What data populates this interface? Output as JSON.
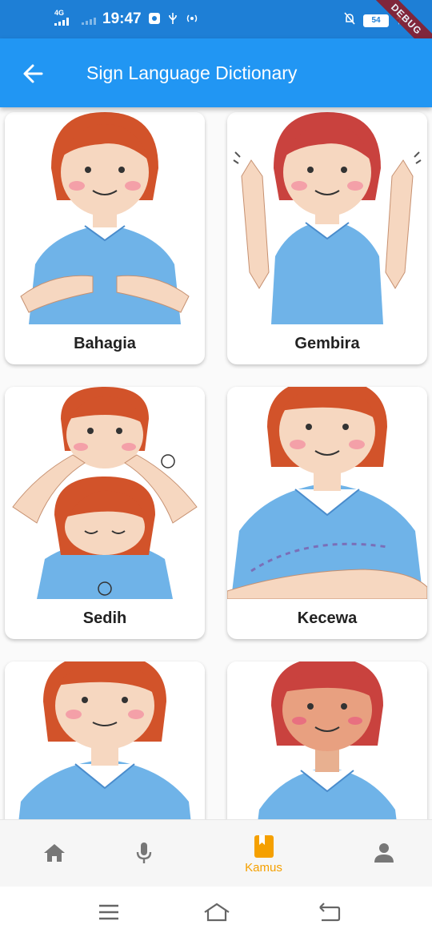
{
  "status_bar": {
    "network": "4G",
    "time": "19:47",
    "battery": "54",
    "debug": "DEBUG"
  },
  "app_bar": {
    "title": "Sign Language Dictionary"
  },
  "cards": [
    {
      "label": "Bahagia"
    },
    {
      "label": "Gembira"
    },
    {
      "label": "Sedih"
    },
    {
      "label": "Kecewa"
    },
    {
      "label": ""
    },
    {
      "label": ""
    }
  ],
  "bottom_nav": {
    "items": [
      {
        "icon": "home-icon",
        "label": ""
      },
      {
        "icon": "microphone-icon",
        "label": ""
      },
      {
        "icon": "book-icon",
        "label": "Kamus",
        "active": true
      },
      {
        "icon": "person-icon",
        "label": ""
      }
    ],
    "active_color": "#f5a000",
    "inactive_color": "#777777"
  },
  "colors": {
    "status_bar": "#1e7fd6",
    "app_bar": "#2196f3",
    "shirt": "#6fb3e8",
    "hair": "#d2532a"
  }
}
